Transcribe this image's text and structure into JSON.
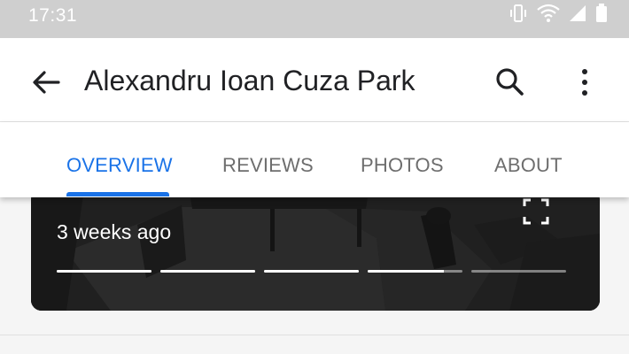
{
  "status_bar": {
    "time": "17:31",
    "icons": [
      "vibrate-icon",
      "wifi-icon",
      "signal-icon",
      "battery-icon"
    ],
    "color": "#ffffff"
  },
  "app_bar": {
    "title": "Alexandru Ioan Cuza Park",
    "back_icon": "arrow-back-icon",
    "search_icon": "search-icon",
    "more_icon": "more-vert-icon"
  },
  "tabs": {
    "items": [
      {
        "label": "OVERVIEW",
        "active": true
      },
      {
        "label": "REVIEWS",
        "active": false
      },
      {
        "label": "PHOTOS",
        "active": false
      },
      {
        "label": "ABOUT",
        "active": false
      }
    ],
    "accent_color": "#1a73e8",
    "inactive_color": "#6e6e6e"
  },
  "photo_card": {
    "time_ago": "3 weeks ago",
    "fullscreen_icon": "fullscreen-icon",
    "progress": [
      1.0,
      1.0,
      1.0,
      0.8,
      0.0
    ]
  }
}
